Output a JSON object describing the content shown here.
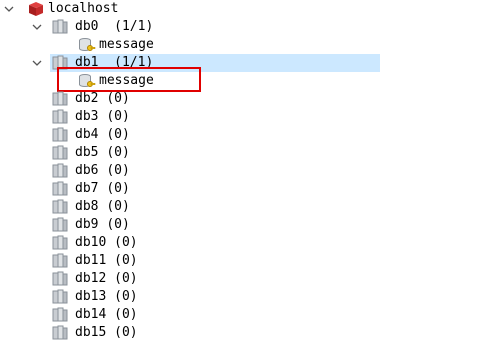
{
  "tree": {
    "root": {
      "label": "localhost",
      "icon": "redis-server-icon",
      "expanded": true
    },
    "databases": [
      {
        "label": "db0",
        "count": "(1/1)",
        "expanded": true,
        "keys": [
          "message"
        ]
      },
      {
        "label": "db1",
        "count": "(1/1)",
        "expanded": true,
        "selected": true,
        "keys": [
          "message"
        ]
      },
      {
        "label": "db2",
        "count": "(0)"
      },
      {
        "label": "db3",
        "count": "(0)"
      },
      {
        "label": "db4",
        "count": "(0)"
      },
      {
        "label": "db5",
        "count": "(0)"
      },
      {
        "label": "db6",
        "count": "(0)"
      },
      {
        "label": "db7",
        "count": "(0)"
      },
      {
        "label": "db8",
        "count": "(0)"
      },
      {
        "label": "db9",
        "count": "(0)"
      },
      {
        "label": "db10",
        "count": "(0)"
      },
      {
        "label": "db11",
        "count": "(0)"
      },
      {
        "label": "db12",
        "count": "(0)"
      },
      {
        "label": "db13",
        "count": "(0)"
      },
      {
        "label": "db14",
        "count": "(0)"
      },
      {
        "label": "db15",
        "count": "(0)"
      }
    ]
  },
  "colors": {
    "selection": "#cce8ff",
    "highlight_border": "#e00000",
    "root_icon": "#cc2222",
    "db_icon": "#8a9199",
    "key_icon": "#d4a017"
  }
}
